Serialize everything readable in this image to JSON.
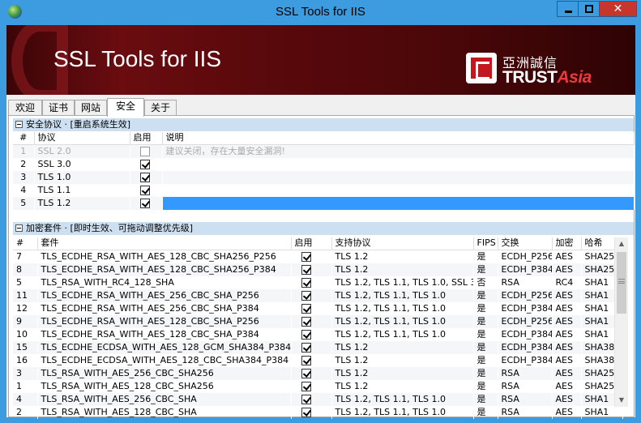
{
  "window": {
    "title": "SSL Tools for IIS",
    "controls": {
      "minimize": "minimize",
      "maximize": "maximize",
      "close": "✕"
    }
  },
  "banner": {
    "title": "SSL Tools for IIS",
    "brand_cn": "亞洲誠信",
    "brand_en_trust": "TRUST",
    "brand_en_asia": "Asia"
  },
  "tabs": [
    "欢迎",
    "证书",
    "网站",
    "安全",
    "关于"
  ],
  "active_tab": "安全",
  "protocols": {
    "group_title": "安全协议 · [重启系统生效]",
    "columns": [
      "#",
      "协议",
      "启用",
      "说明"
    ],
    "rows": [
      {
        "num": "1",
        "name": "SSL 2.0",
        "enabled": false,
        "desc": "建议关闭，存在大量安全漏洞!",
        "disabled": true
      },
      {
        "num": "2",
        "name": "SSL 3.0",
        "enabled": true,
        "desc": ""
      },
      {
        "num": "3",
        "name": "TLS 1.0",
        "enabled": true,
        "desc": ""
      },
      {
        "num": "4",
        "name": "TLS 1.1",
        "enabled": true,
        "desc": ""
      },
      {
        "num": "5",
        "name": "TLS 1.2",
        "enabled": true,
        "desc": "",
        "selected": true
      }
    ]
  },
  "ciphers": {
    "group_title": "加密套件 · [即时生效、可拖动调整优先级]",
    "columns": [
      "#",
      "套件",
      "启用",
      "支持协议",
      "FIPS",
      "交换",
      "加密",
      "哈希"
    ],
    "rows": [
      {
        "num": "7",
        "suite": "TLS_ECDHE_RSA_WITH_AES_128_CBC_SHA256_P256",
        "enabled": true,
        "protocols": "TLS 1.2",
        "fips": "是",
        "exchange": "ECDH_P256",
        "cipher": "AES",
        "hash": "SHA256"
      },
      {
        "num": "8",
        "suite": "TLS_ECDHE_RSA_WITH_AES_128_CBC_SHA256_P384",
        "enabled": true,
        "protocols": "TLS 1.2",
        "fips": "是",
        "exchange": "ECDH_P384",
        "cipher": "AES",
        "hash": "SHA256"
      },
      {
        "num": "5",
        "suite": "TLS_RSA_WITH_RC4_128_SHA",
        "enabled": true,
        "protocols": "TLS 1.2, TLS 1.1, TLS 1.0, SSL 3.0",
        "fips": "否",
        "exchange": "RSA",
        "cipher": "RC4",
        "hash": "SHA1"
      },
      {
        "num": "11",
        "suite": "TLS_ECDHE_RSA_WITH_AES_256_CBC_SHA_P256",
        "enabled": true,
        "protocols": "TLS 1.2, TLS 1.1, TLS 1.0",
        "fips": "是",
        "exchange": "ECDH_P256",
        "cipher": "AES",
        "hash": "SHA1"
      },
      {
        "num": "12",
        "suite": "TLS_ECDHE_RSA_WITH_AES_256_CBC_SHA_P384",
        "enabled": true,
        "protocols": "TLS 1.2, TLS 1.1, TLS 1.0",
        "fips": "是",
        "exchange": "ECDH_P384",
        "cipher": "AES",
        "hash": "SHA1"
      },
      {
        "num": "9",
        "suite": "TLS_ECDHE_RSA_WITH_AES_128_CBC_SHA_P256",
        "enabled": true,
        "protocols": "TLS 1.2, TLS 1.1, TLS 1.0",
        "fips": "是",
        "exchange": "ECDH_P256",
        "cipher": "AES",
        "hash": "SHA1"
      },
      {
        "num": "10",
        "suite": "TLS_ECDHE_RSA_WITH_AES_128_CBC_SHA_P384",
        "enabled": true,
        "protocols": "TLS 1.2, TLS 1.1, TLS 1.0",
        "fips": "是",
        "exchange": "ECDH_P384",
        "cipher": "AES",
        "hash": "SHA1"
      },
      {
        "num": "15",
        "suite": "TLS_ECDHE_ECDSA_WITH_AES_128_GCM_SHA384_P384",
        "enabled": true,
        "protocols": "TLS 1.2",
        "fips": "是",
        "exchange": "ECDH_P384",
        "cipher": "AES",
        "hash": "SHA384"
      },
      {
        "num": "16",
        "suite": "TLS_ECDHE_ECDSA_WITH_AES_128_CBC_SHA384_P384",
        "enabled": true,
        "protocols": "TLS 1.2",
        "fips": "是",
        "exchange": "ECDH_P384",
        "cipher": "AES",
        "hash": "SHA384"
      },
      {
        "num": "3",
        "suite": "TLS_RSA_WITH_AES_256_CBC_SHA256",
        "enabled": true,
        "protocols": "TLS 1.2",
        "fips": "是",
        "exchange": "RSA",
        "cipher": "AES",
        "hash": "SHA256"
      },
      {
        "num": "1",
        "suite": "TLS_RSA_WITH_AES_128_CBC_SHA256",
        "enabled": true,
        "protocols": "TLS 1.2",
        "fips": "是",
        "exchange": "RSA",
        "cipher": "AES",
        "hash": "SHA256"
      },
      {
        "num": "4",
        "suite": "TLS_RSA_WITH_AES_256_CBC_SHA",
        "enabled": true,
        "protocols": "TLS 1.2, TLS 1.1, TLS 1.0",
        "fips": "是",
        "exchange": "RSA",
        "cipher": "AES",
        "hash": "SHA1"
      },
      {
        "num": "2",
        "suite": "TLS_RSA_WITH_AES_128_CBC_SHA",
        "enabled": true,
        "protocols": "TLS 1.2, TLS 1.1, TLS 1.0",
        "fips": "是",
        "exchange": "RSA",
        "cipher": "AES",
        "hash": "SHA1"
      }
    ]
  },
  "scrollbar": {
    "up": "▲",
    "down": "▼"
  },
  "colors": {
    "titlebar": "#3d9bdf",
    "close": "#c7362d",
    "banner": "#5a090c",
    "selection": "#3399ff",
    "group_header": "#cde0f2"
  }
}
